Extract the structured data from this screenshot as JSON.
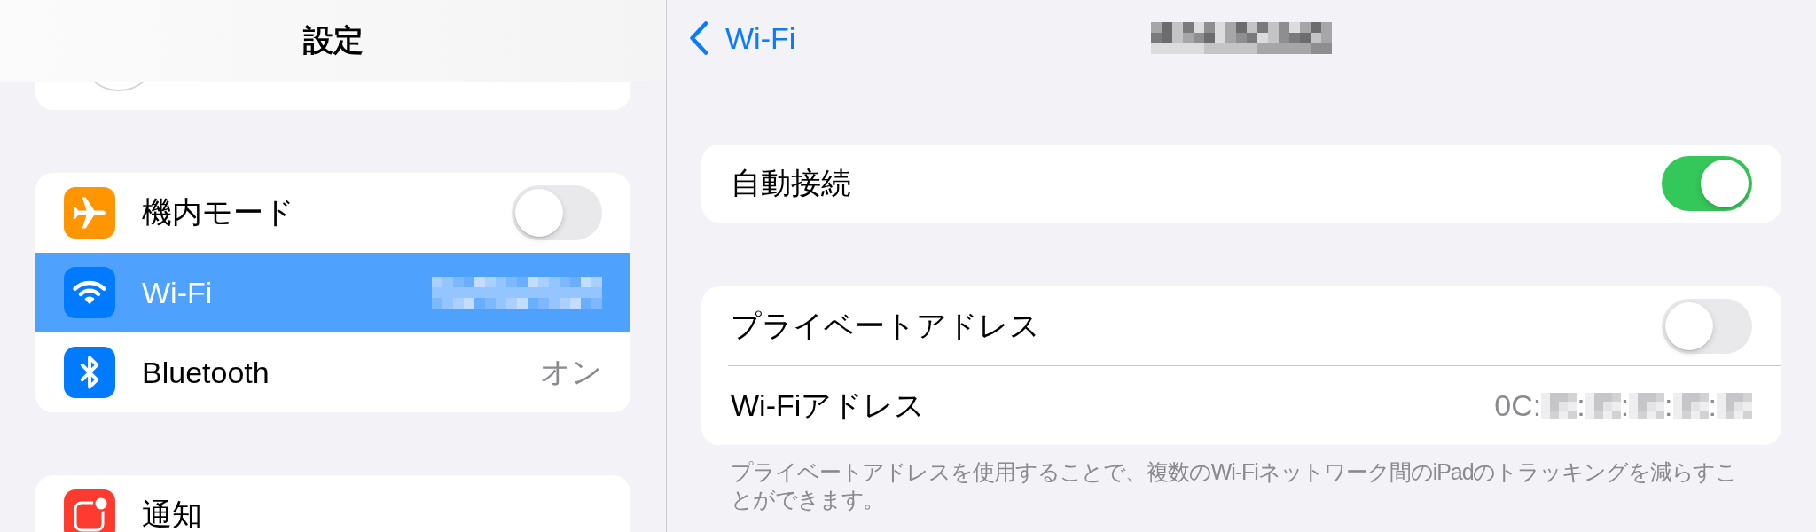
{
  "sidebar": {
    "title": "設定",
    "groups": [
      {
        "kind": "profile"
      },
      {
        "kind": "list",
        "items": [
          {
            "kind": "toggle",
            "label": "機内モード",
            "on": false,
            "selected": false,
            "color": "#ff9500"
          },
          {
            "kind": "value",
            "label": "Wi-Fi",
            "value_parts": [
              {
                "kind": "redacted"
              }
            ],
            "selected": true,
            "color": "#007aff"
          },
          {
            "kind": "value",
            "label": "Bluetooth",
            "value_parts": [
              {
                "kind": "text",
                "text": "オン"
              }
            ],
            "selected": false,
            "color": "#007aff"
          }
        ]
      },
      {
        "kind": "list",
        "items": [
          {
            "kind": "link",
            "label": "通知",
            "selected": false,
            "color": "#ff3b30"
          }
        ]
      }
    ]
  },
  "detail": {
    "back": {
      "label": "Wi-Fi"
    },
    "title_parts": [
      {
        "kind": "redacted"
      }
    ],
    "groups": [
      {
        "rows": [
          {
            "kind": "toggle",
            "label": "自動接続",
            "on": true
          }
        ]
      },
      {
        "rows": [
          {
            "kind": "toggle",
            "label": "プライベートアドレス",
            "on": false
          },
          {
            "kind": "value",
            "label": "Wi-Fiアドレス",
            "value_parts": [
              {
                "kind": "text",
                "text": "0C:"
              },
              {
                "kind": "redacted"
              },
              {
                "kind": "text",
                "text": ":"
              },
              {
                "kind": "redacted"
              },
              {
                "kind": "text",
                "text": ":"
              },
              {
                "kind": "redacted"
              },
              {
                "kind": "text",
                "text": ":"
              },
              {
                "kind": "redacted"
              },
              {
                "kind": "text",
                "text": ":"
              },
              {
                "kind": "redacted"
              }
            ]
          }
        ],
        "footer": "プライベートアドレスを使用することで、複数のWi-Fiネットワーク間のiPadのトラッキングを減らすことができます。"
      }
    ]
  }
}
